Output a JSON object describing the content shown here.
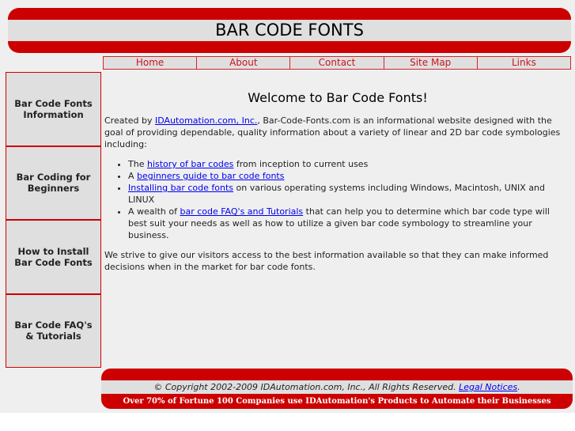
{
  "header": {
    "title": "BAR CODE FONTS"
  },
  "nav": [
    "Home",
    "About",
    "Contact",
    "Site Map",
    "Links"
  ],
  "sidebar": [
    "Bar Code Fonts Information",
    "Bar Coding for Beginners",
    "How to Install Bar Code Fonts",
    "Bar Code FAQ's & Tutorials"
  ],
  "main": {
    "title": "Welcome to Bar Code Fonts!",
    "intro_pre": "Created by ",
    "intro_link": "IDAutomation.com, Inc.",
    "intro_post": ", Bar-Code-Fonts.com is an informational website designed with the goal of providing dependable, quality information about a variety of linear and 2D bar code symbologies including:",
    "bullets": [
      {
        "pre": "The ",
        "link": "history of bar codes",
        "post": " from inception to current uses"
      },
      {
        "pre": "A ",
        "link": "beginners guide to bar code fonts",
        "post": ""
      },
      {
        "pre": "",
        "link": "Installing bar code fonts",
        "post": " on various operating systems including Windows, Macintosh, UNIX and LINUX"
      },
      {
        "pre": "A wealth of ",
        "link": "bar code FAQ's and Tutorials",
        "post": " that can help you to determine which bar code type will best suit your needs as well as how to utilize a given bar code symbology to streamline your business."
      }
    ],
    "closing": "We strive to give our visitors access to the best information available so that they can make informed decisions when in the market for bar code fonts."
  },
  "footer": {
    "copyright": "© Copyright 2002-2009 IDAutomation.com, Inc., All Rights Reserved. ",
    "legal": "Legal Notices",
    "period": ".",
    "tagline": "Over 70% of Fortune 100 Companies use IDAutomation's Products to Automate their Businesses"
  }
}
